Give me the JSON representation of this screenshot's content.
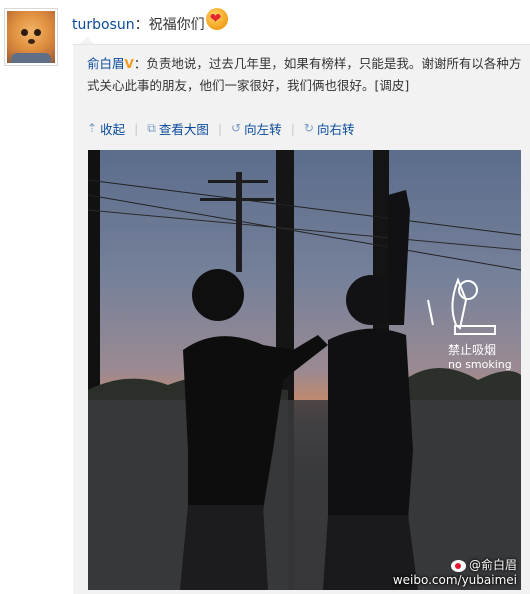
{
  "post": {
    "username": "turbosun",
    "colon": "：",
    "text": "祝福你们",
    "emoji": "heart-emoji"
  },
  "repost": {
    "original_user": "俞白眉",
    "vip_badge": "V",
    "text": "：负责地说，过去几年里，如果有榜样，只能是我。谢谢所有以各种方式关心此事的朋友，他们一家很好，我们俩也很好。[调皮]",
    "actions": [
      {
        "label": "收起",
        "icon": "collapse-arrow-icon"
      },
      {
        "label": "查看大图",
        "icon": "enlarge-icon"
      },
      {
        "label": "向左转",
        "icon": "rotate-left-icon"
      },
      {
        "label": "向右转",
        "icon": "rotate-right-icon"
      }
    ],
    "separator": "|"
  },
  "photo": {
    "sign_text_cn": "禁止吸烟",
    "sign_text_en": "no smoking",
    "watermark_name": "@俞白眉",
    "watermark_url": "weibo.com/yubaimei"
  },
  "colors": {
    "link": "#0a4b9c",
    "repost_bg": "#f2f2f2",
    "vip": "#f29a1c"
  }
}
